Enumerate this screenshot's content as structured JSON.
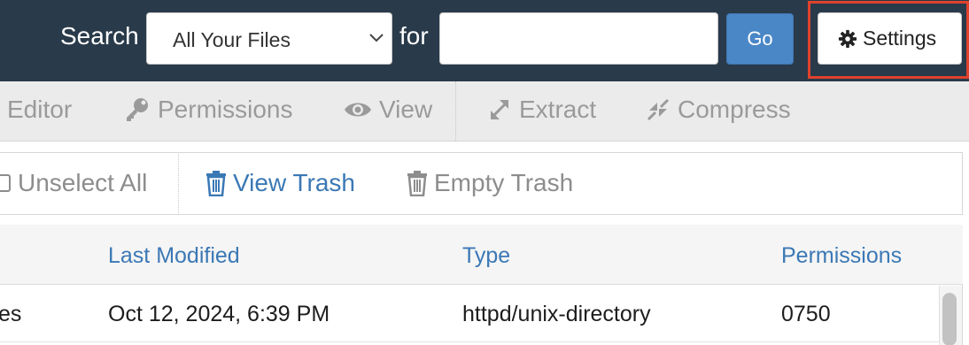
{
  "search": {
    "label": "Search",
    "scope_selected": "All Your Files",
    "for_label": "for",
    "query_value": "",
    "go_label": "Go"
  },
  "settings": {
    "label": "Settings"
  },
  "toolbar": {
    "items": [
      {
        "label": "Editor",
        "icon": "html-editor-icon"
      },
      {
        "label": "Permissions",
        "icon": "key-icon"
      },
      {
        "label": "View",
        "icon": "eye-icon"
      },
      {
        "label": "Extract",
        "icon": "expand-arrows-icon"
      },
      {
        "label": "Compress",
        "icon": "compress-arrows-icon"
      }
    ]
  },
  "actions": {
    "unselect_all": "Unselect All",
    "view_trash": "View Trash",
    "empty_trash": "Empty Trash"
  },
  "table": {
    "columns": [
      "Last Modified",
      "Type",
      "Permissions"
    ],
    "rows": [
      {
        "name_fragment": "es",
        "last_modified": "Oct 12, 2024, 6:39 PM",
        "type": "httpd/unix-directory",
        "permissions": "0750"
      }
    ]
  },
  "colors": {
    "topbar_bg": "#293a4a",
    "accent_blue": "#4a87c7",
    "link_blue": "#3b78b5",
    "highlight_red": "#e0422c",
    "disabled_gray": "#9a9a9a"
  }
}
